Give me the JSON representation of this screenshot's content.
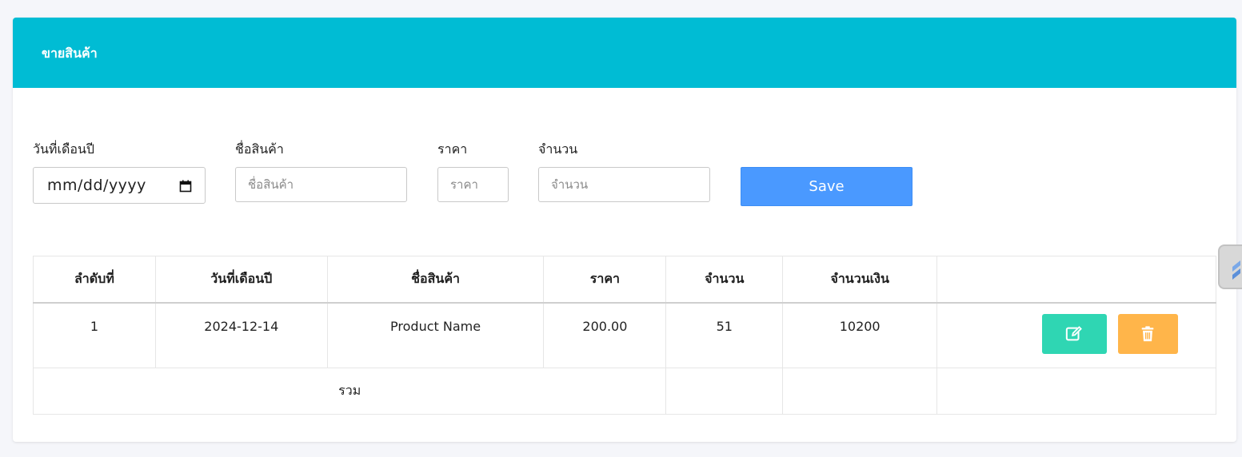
{
  "header": {
    "title": "ขายสินค้า"
  },
  "form": {
    "date_label": "วันที่เดือนปี",
    "date_placeholder": "mm/dd/yyyy",
    "name_label": "ชื่อสินค้า",
    "name_placeholder": "ชื่อสินค้า",
    "price_label": "ราคา",
    "price_placeholder": "ราคา",
    "qty_label": "จำนวน",
    "qty_placeholder": "จำนวน",
    "save_label": "Save"
  },
  "table": {
    "headers": [
      "ลำดับที่",
      "วันที่เดือนปี",
      "ชื่อสินค้า",
      "ราคา",
      "จำนวน",
      "จำนวนเงิน",
      ""
    ],
    "rows": [
      {
        "no": "1",
        "date": "2024-12-14",
        "name": "Product Name",
        "price": "200.00",
        "qty": "51",
        "amount": "10200"
      }
    ],
    "total_label": "รวม"
  },
  "colors": {
    "header_bg": "#00bcd4",
    "save_bg": "#4a99ff",
    "edit_bg": "#2fd6b3",
    "delete_bg": "#ffb54a"
  },
  "icons": {
    "calendar": "calendar-icon",
    "edit": "edit-icon",
    "delete": "trash-icon"
  }
}
